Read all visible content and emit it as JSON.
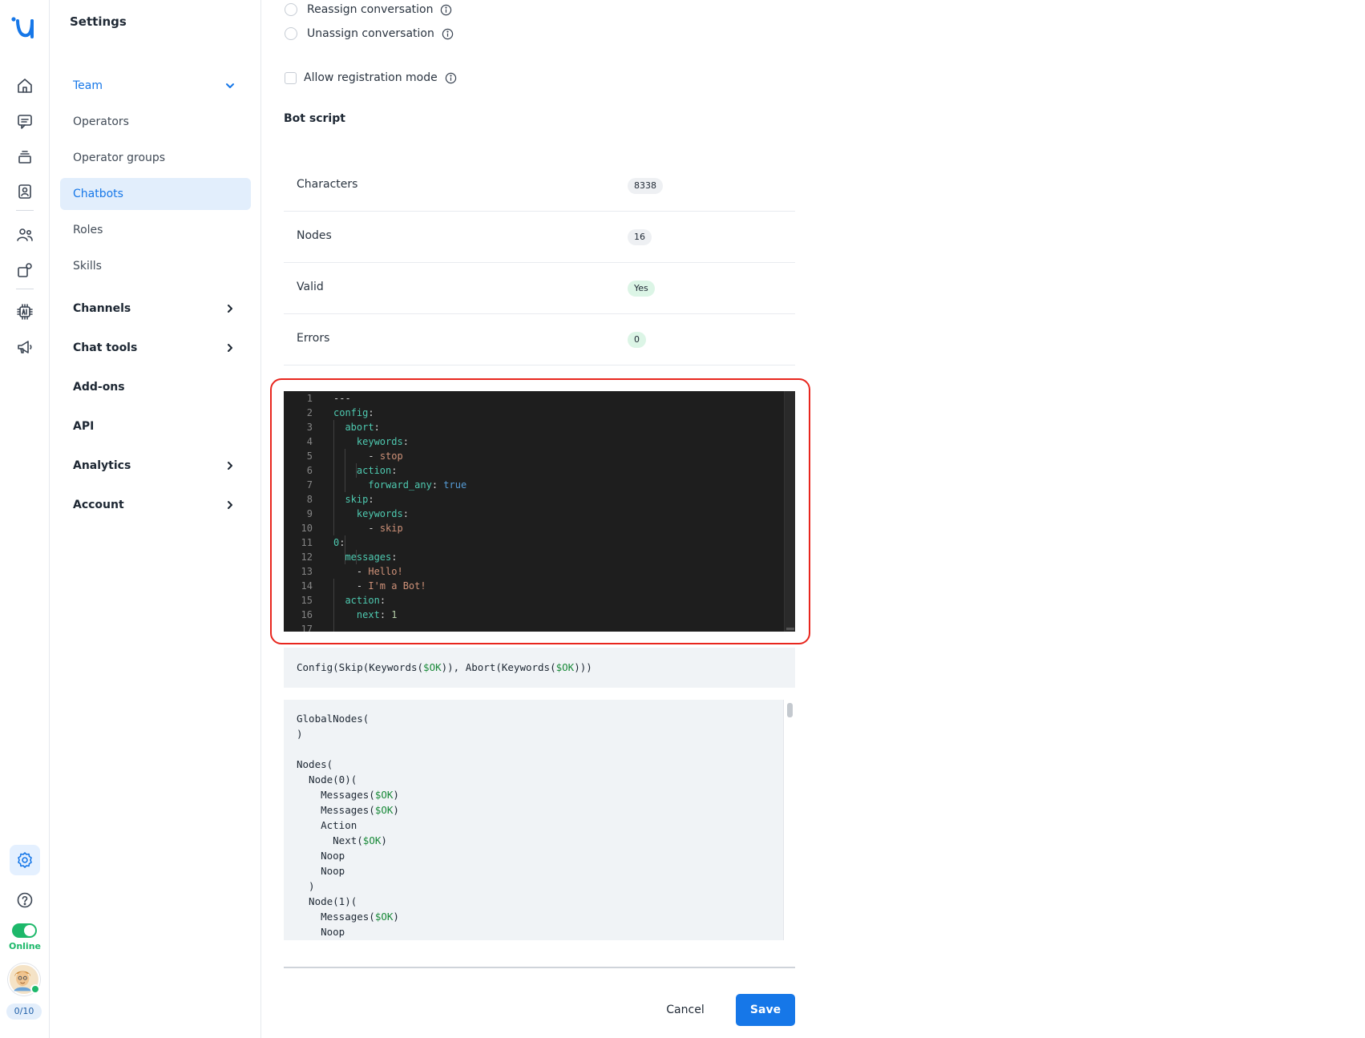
{
  "nav": {
    "online_label": "Online",
    "counter": "0/10",
    "accent_color": "#1677e8",
    "online_color": "#1db86a"
  },
  "settings_menu": {
    "title": "Settings",
    "team": {
      "label": "Team",
      "expanded": true
    },
    "team_items": [
      {
        "label": "Operators",
        "active": false
      },
      {
        "label": "Operator groups",
        "active": false
      },
      {
        "label": "Chatbots",
        "active": true
      },
      {
        "label": "Roles",
        "active": false
      },
      {
        "label": "Skills",
        "active": false
      }
    ],
    "sections": [
      {
        "label": "Channels",
        "has_chevron": true
      },
      {
        "label": "Chat tools",
        "has_chevron": true
      },
      {
        "label": "Add-ons",
        "has_chevron": false
      },
      {
        "label": "API",
        "has_chevron": false
      },
      {
        "label": "Analytics",
        "has_chevron": true
      },
      {
        "label": "Account",
        "has_chevron": true
      }
    ]
  },
  "options": {
    "reassign": {
      "label": "Reassign conversation",
      "checked": false
    },
    "unassign": {
      "label": "Unassign conversation",
      "checked": false
    },
    "registration": {
      "label": "Allow registration mode",
      "checked": false
    }
  },
  "bot_script": {
    "heading": "Bot script",
    "stats": [
      {
        "label": "Characters",
        "value": "8338",
        "color": "#eef0f3"
      },
      {
        "label": "Nodes",
        "value": "16",
        "color": "#eef0f3"
      },
      {
        "label": "Valid",
        "value": "Yes",
        "color": "#dcf5e6"
      },
      {
        "label": "Errors",
        "value": "0",
        "color": "#dcf5e6"
      }
    ],
    "code_lines": [
      "1",
      "2",
      "3",
      "4",
      "5",
      "6",
      "7",
      "8",
      "9",
      "10",
      "11",
      "12",
      "13",
      "14",
      "15",
      "16",
      "17"
    ],
    "code": {
      "l1": "---",
      "l2_key": "config",
      "l3_key": "abort",
      "l4_key": "keywords",
      "l5_val": "stop",
      "l6_key": "action",
      "l7_key": "forward_any",
      "l7_val": "true",
      "l8_key": "skip",
      "l9_key": "keywords",
      "l10_val": "skip",
      "l11_key": "0",
      "l12_key": "messages",
      "l13_val": "Hello!",
      "l14_val": "I'm a Bot!",
      "l15_key": "action",
      "l16_key": "next",
      "l16_val": "1"
    },
    "summary": {
      "prefix": "Config(Skip(Keywords(",
      "ok1": "$OK",
      "mid": ")), Abort(Keywords(",
      "ok2": "$OK",
      "suffix": ")))"
    },
    "tree": [
      {
        "text": "GlobalNodes(",
        "ok": "",
        "tail": ""
      },
      {
        "text": ")",
        "ok": "",
        "tail": ""
      },
      {
        "text": "",
        "ok": "",
        "tail": ""
      },
      {
        "text": "Nodes(",
        "ok": "",
        "tail": ""
      },
      {
        "text": "  Node(0)(",
        "ok": "",
        "tail": ""
      },
      {
        "text": "    Messages(",
        "ok": "$OK",
        "tail": ")"
      },
      {
        "text": "    Messages(",
        "ok": "$OK",
        "tail": ")"
      },
      {
        "text": "    Action",
        "ok": "",
        "tail": ""
      },
      {
        "text": "      Next(",
        "ok": "$OK",
        "tail": ")"
      },
      {
        "text": "    Noop",
        "ok": "",
        "tail": ""
      },
      {
        "text": "    Noop",
        "ok": "",
        "tail": ""
      },
      {
        "text": "  )",
        "ok": "",
        "tail": ""
      },
      {
        "text": "  Node(1)(",
        "ok": "",
        "tail": ""
      },
      {
        "text": "    Messages(",
        "ok": "$OK",
        "tail": ")"
      },
      {
        "text": "    Noop",
        "ok": "",
        "tail": ""
      }
    ]
  },
  "actions": {
    "cancel": "Cancel",
    "save": "Save"
  }
}
